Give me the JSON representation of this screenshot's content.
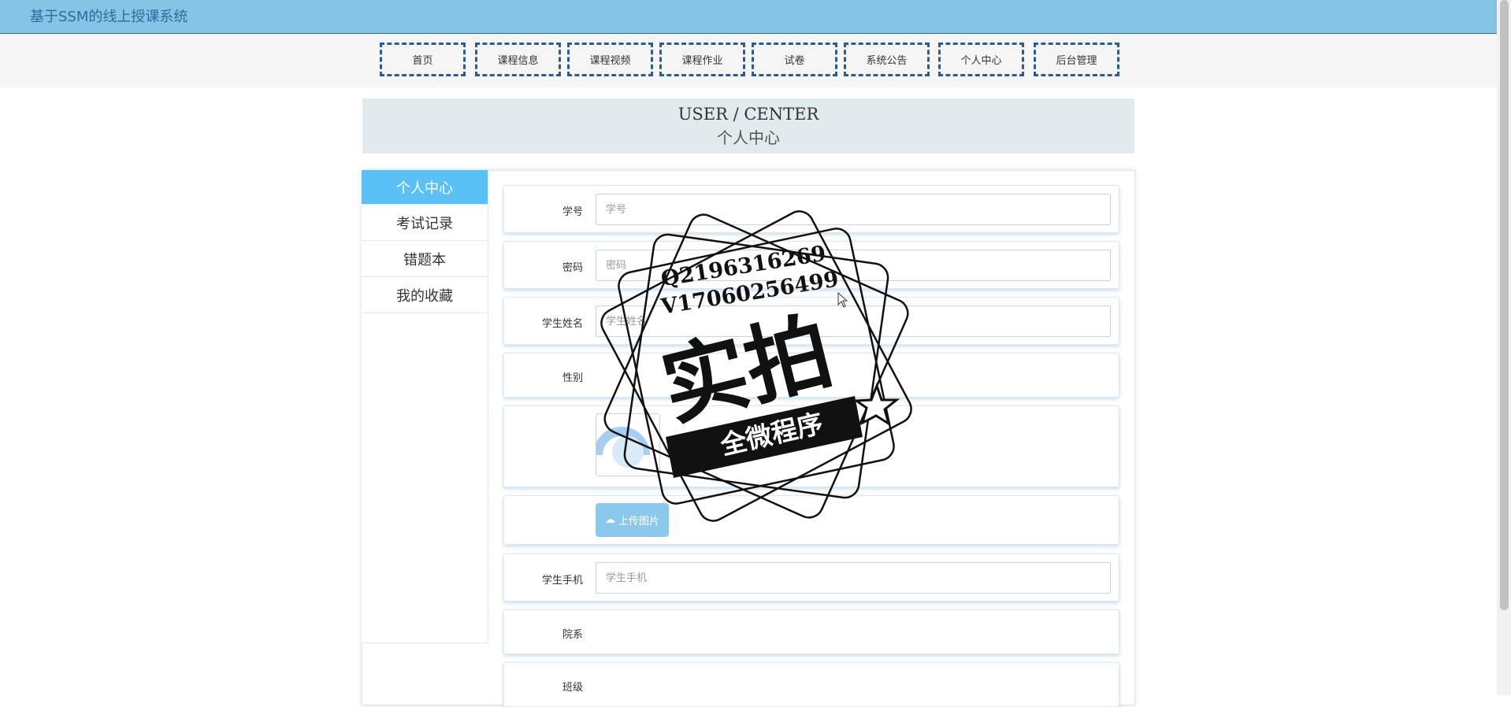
{
  "site": {
    "title": "基于SSM的线上授课系统"
  },
  "nav": [
    {
      "label": "首页"
    },
    {
      "label": "课程信息"
    },
    {
      "label": "课程视频"
    },
    {
      "label": "课程作业"
    },
    {
      "label": "试卷"
    },
    {
      "label": "系统公告"
    },
    {
      "label": "个人中心"
    },
    {
      "label": "后台管理"
    }
  ],
  "banner": {
    "en": "USER / CENTER",
    "zh": "个人中心"
  },
  "sidebar": [
    {
      "label": "个人中心",
      "active": true
    },
    {
      "label": "考试记录"
    },
    {
      "label": "错题本"
    },
    {
      "label": "我的收藏"
    }
  ],
  "form": {
    "student_id": {
      "label": "学号",
      "placeholder": "学号",
      "value": ""
    },
    "password": {
      "label": "密码",
      "placeholder": "密码",
      "value": ""
    },
    "student_name": {
      "label": "学生姓名",
      "placeholder": "学生姓名",
      "value": ""
    },
    "gender": {
      "label": "性别"
    },
    "upload": {
      "label": "上传图片"
    },
    "phone": {
      "label": "学生手机",
      "placeholder": "学生手机",
      "value": ""
    },
    "department": {
      "label": "院系"
    },
    "class": {
      "label": "班级"
    }
  },
  "watermark": {
    "line1": "Q2196316269",
    "line2": "V17060256499",
    "main": "实拍",
    "ribbon": "全微程序"
  },
  "colors": {
    "topbar": "#86c4e5",
    "accent": "#5bc0f5",
    "nav_border": "#2e5a8c",
    "upload_button": "#8cc8ec"
  }
}
